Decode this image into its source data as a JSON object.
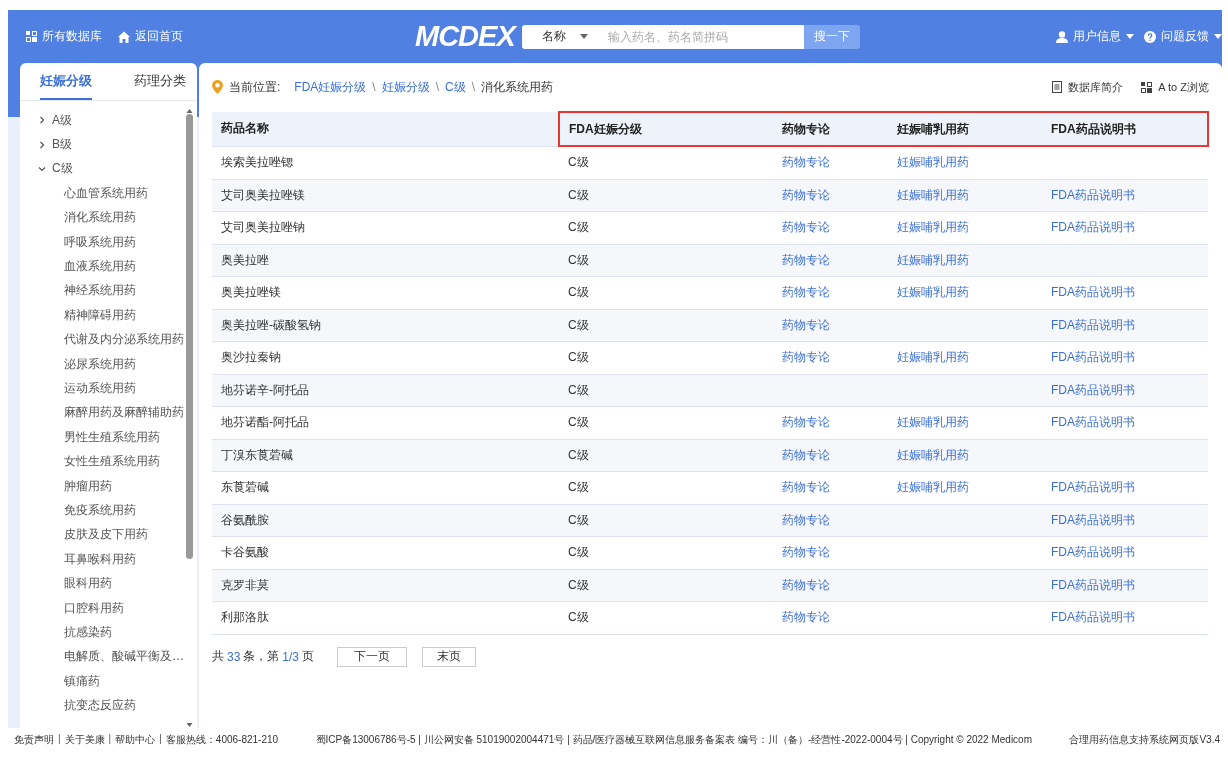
{
  "header": {
    "nav_left": [
      {
        "label": "所有数据库"
      },
      {
        "label": "返回首页"
      }
    ],
    "logo": "MCDEX",
    "search": {
      "scope": "名称",
      "placeholder": "输入药名、药名简拼码",
      "button": "搜一下"
    },
    "nav_right": [
      {
        "label": "用户信息"
      },
      {
        "label": "问题反馈"
      }
    ]
  },
  "sidebar": {
    "tabs": [
      {
        "label": "妊娠分级",
        "selected": true
      },
      {
        "label": "药理分类",
        "selected": false
      }
    ],
    "tree": [
      {
        "label": "A级",
        "expanded": false
      },
      {
        "label": "B级",
        "expanded": false
      },
      {
        "label": "C级",
        "expanded": true,
        "children": [
          {
            "label": "心血管系统用药"
          },
          {
            "label": "消化系统用药"
          },
          {
            "label": "呼吸系统用药"
          },
          {
            "label": "血液系统用药"
          },
          {
            "label": "神经系统用药"
          },
          {
            "label": "精神障碍用药"
          },
          {
            "label": "代谢及内分泌系统用药"
          },
          {
            "label": "泌尿系统用药"
          },
          {
            "label": "运动系统用药"
          },
          {
            "label": "麻醉用药及麻醉辅助药"
          },
          {
            "label": "男性生殖系统用药"
          },
          {
            "label": "女性生殖系统用药"
          },
          {
            "label": "肿瘤用药"
          },
          {
            "label": "免疫系统用药"
          },
          {
            "label": "皮肤及皮下用药"
          },
          {
            "label": "耳鼻喉科用药"
          },
          {
            "label": "眼科用药"
          },
          {
            "label": "口腔科用药"
          },
          {
            "label": "抗感染药"
          },
          {
            "label": "电解质、酸碱平衡及…"
          },
          {
            "label": "镇痛药"
          },
          {
            "label": "抗变态反应药"
          }
        ]
      }
    ]
  },
  "breadcrumb": {
    "label": "当前位置:",
    "separator": "\\",
    "items": [
      {
        "label": "FDA妊娠分级",
        "kind": "link"
      },
      {
        "label": "妊娠分级",
        "kind": "link"
      },
      {
        "label": "C级",
        "kind": "link"
      },
      {
        "label": "消化系统用药",
        "kind": "current"
      }
    ]
  },
  "tools": [
    {
      "label": "数据库简介"
    },
    {
      "label": "A to Z浏览"
    }
  ],
  "table": {
    "columns": [
      {
        "label": "药品名称",
        "kind": "text",
        "highlighted": false
      },
      {
        "label": "FDA妊娠分级",
        "kind": "text",
        "highlighted": true
      },
      {
        "label": "药物专论",
        "kind": "link",
        "highlighted": true
      },
      {
        "label": "妊娠哺乳用药",
        "kind": "link",
        "highlighted": true
      },
      {
        "label": "FDA药品说明书",
        "kind": "link",
        "highlighted": true
      }
    ],
    "rows": [
      [
        "埃索美拉唑锶",
        "C级",
        "药物专论",
        "妊娠哺乳用药",
        null
      ],
      [
        "艾司奥美拉唑镁",
        "C级",
        "药物专论",
        "妊娠哺乳用药",
        "FDA药品说明书"
      ],
      [
        "艾司奥美拉唑钠",
        "C级",
        "药物专论",
        "妊娠哺乳用药",
        "FDA药品说明书"
      ],
      [
        "奥美拉唑",
        "C级",
        "药物专论",
        "妊娠哺乳用药",
        null
      ],
      [
        "奥美拉唑镁",
        "C级",
        "药物专论",
        "妊娠哺乳用药",
        "FDA药品说明书"
      ],
      [
        "奥美拉唑-碳酸氢钠",
        "C级",
        "药物专论",
        null,
        "FDA药品说明书"
      ],
      [
        "奥沙拉秦钠",
        "C级",
        "药物专论",
        "妊娠哺乳用药",
        "FDA药品说明书"
      ],
      [
        "地芬诺辛-阿托品",
        "C级",
        null,
        null,
        "FDA药品说明书"
      ],
      [
        "地芬诺酯-阿托品",
        "C级",
        "药物专论",
        "妊娠哺乳用药",
        "FDA药品说明书"
      ],
      [
        "丁溴东莨菪碱",
        "C级",
        "药物专论",
        "妊娠哺乳用药",
        null
      ],
      [
        "东莨菪碱",
        "C级",
        "药物专论",
        "妊娠哺乳用药",
        "FDA药品说明书"
      ],
      [
        "谷氨酰胺",
        "C级",
        "药物专论",
        null,
        "FDA药品说明书"
      ],
      [
        "卡谷氨酸",
        "C级",
        "药物专论",
        null,
        "FDA药品说明书"
      ],
      [
        "克罗非莫",
        "C级",
        "药物专论",
        null,
        "FDA药品说明书"
      ],
      [
        "利那洛肽",
        "C级",
        "药物专论",
        null,
        "FDA药品说明书"
      ]
    ]
  },
  "pagination": {
    "prefix": "共",
    "total": "33",
    "middle": "条，第",
    "page": "1/3",
    "suffix": "页",
    "buttons": [
      "下一页",
      "末页"
    ]
  },
  "footer": {
    "links": [
      "免责声明",
      "关于美康",
      "帮助中心",
      "客服热线：4006-821-210"
    ],
    "separator": "|",
    "center": "蜀ICP备13006786号-5 | 川公网安备 51019002004471号 | 药品/医疗器械互联网信息服务备案表 编号：川（备）-经营性-2022-0004号 | Copyright © 2022 Medicom",
    "right": "合理用药信息支持系统网页版V3.4"
  }
}
